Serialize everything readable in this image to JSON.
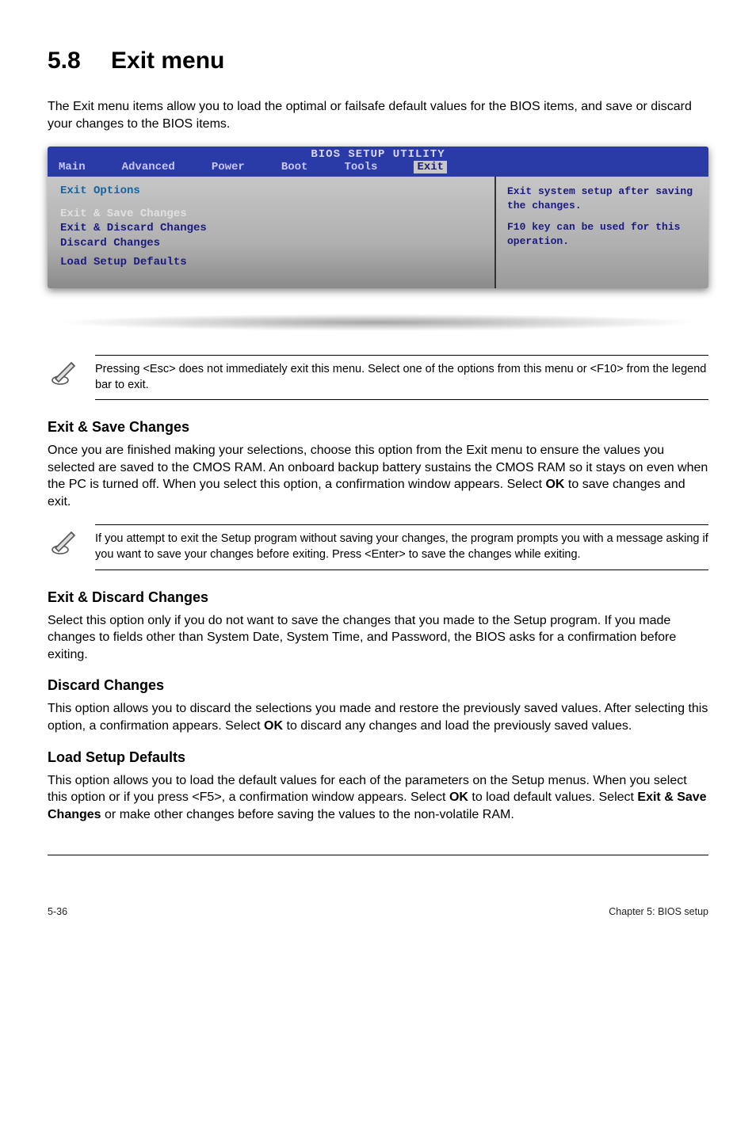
{
  "heading": {
    "num": "5.8",
    "title": "Exit menu"
  },
  "intro": "The Exit menu items allow you to load the optimal or failsafe default values for the BIOS items, and save or discard your changes to the BIOS items.",
  "bios": {
    "title": "BIOS SETUP UTILITY",
    "menu": {
      "main": "Main",
      "advanced": "Advanced",
      "power": "Power",
      "boot": "Boot",
      "tools": "Tools",
      "exit": "Exit"
    },
    "left": {
      "heading": "Exit Options",
      "l1": "Exit & Save Changes",
      "l2": "Exit & Discard Changes",
      "l3": "Discard Changes",
      "l4": "Load Setup Defaults"
    },
    "right": {
      "r1": "Exit system setup after saving the changes.",
      "r2": "F10 key can be used for this operation."
    }
  },
  "note1": "Pressing <Esc> does not immediately exit this menu. Select one of the options from this menu or <F10> from the legend bar to exit.",
  "s1": {
    "h": "Exit & Save Changes",
    "p": "Once you are finished making your selections, choose this option from the Exit menu to ensure the values you selected are saved to the CMOS RAM. An onboard backup battery sustains the CMOS RAM so it stays on even when the PC is turned off. When you select this option, a confirmation window appears. Select OK to save changes and exit."
  },
  "note2": " If you attempt to exit the Setup program without saving your changes, the program prompts you with a message asking if you want to save your changes before exiting. Press <Enter>  to save the  changes while exiting.",
  "s2": {
    "h": "Exit & Discard Changes",
    "p": "Select this option only if you do not want to save the changes that you  made to the Setup program. If you made changes to fields other than System Date, System Time, and Password, the BIOS asks for a confirmation before exiting."
  },
  "s3": {
    "h": "Discard Changes",
    "p": "This option allows you to discard the selections you made and restore the previously saved values. After selecting this option, a confirmation appears. Select OK to discard any changes and load the previously saved values."
  },
  "s4": {
    "h": "Load Setup Defaults",
    "p": "This option allows you to load the default values for each of the parameters on the Setup menus. When you select this option or if you press <F5>, a confirmation window appears. Select OK to load default values. Select Exit & Save Changes or make other changes before saving the values to the non-volatile RAM."
  },
  "footer": {
    "left": "5-36",
    "right": "Chapter 5: BIOS setup"
  }
}
